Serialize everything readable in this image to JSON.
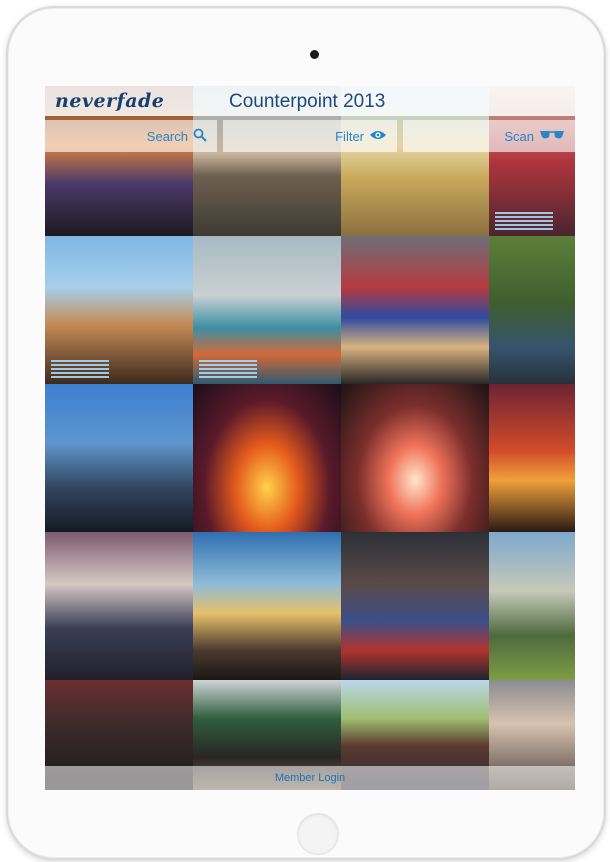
{
  "app": {
    "logo_text": "neverfade",
    "event_title": "Counterpoint 2013"
  },
  "toolbar": {
    "search_label": "Search",
    "filter_label": "Filter",
    "scan_label": "Scan"
  },
  "footer": {
    "login_label": "Member Login"
  },
  "colors": {
    "accent": "#2b84c8",
    "title": "#1c4a7c",
    "stripe": "#a9d8f4"
  },
  "icons": [
    "search-icon",
    "eye-icon",
    "sunglasses-icon"
  ],
  "photos": [
    {
      "scene": "fairground-wheel-crowd",
      "marked": false
    },
    {
      "scene": "valley-landscape",
      "marked": false
    },
    {
      "scene": "festival-crowd-stage",
      "marked": false
    },
    {
      "scene": "festival-goers-colorful",
      "marked": true
    },
    {
      "scene": "crowd-surfer",
      "marked": true
    },
    {
      "scene": "tent-campsite",
      "marked": true
    },
    {
      "scene": "flag-shirt-girl-stage",
      "marked": false
    },
    {
      "scene": "man-in-jacket-trees",
      "marked": false
    },
    {
      "scene": "rapper-on-stage",
      "marked": false
    },
    {
      "scene": "concert-fire-silhouette",
      "marked": false
    },
    {
      "scene": "concert-lights-crowd",
      "marked": false
    },
    {
      "scene": "red-sunset-palms",
      "marked": false
    },
    {
      "scene": "unicorn-mask-fan",
      "marked": false
    },
    {
      "scene": "sunlit-stage-crowd",
      "marked": false
    },
    {
      "scene": "guitarist-singer",
      "marked": false
    },
    {
      "scene": "festival-grounds-people",
      "marked": false
    },
    {
      "scene": "friends-sunglasses",
      "marked": false
    },
    {
      "scene": "cap-man-hand",
      "marked": false
    },
    {
      "scene": "girls-group-photo",
      "marked": false
    },
    {
      "scene": "woman-in-crowd",
      "marked": false
    }
  ]
}
